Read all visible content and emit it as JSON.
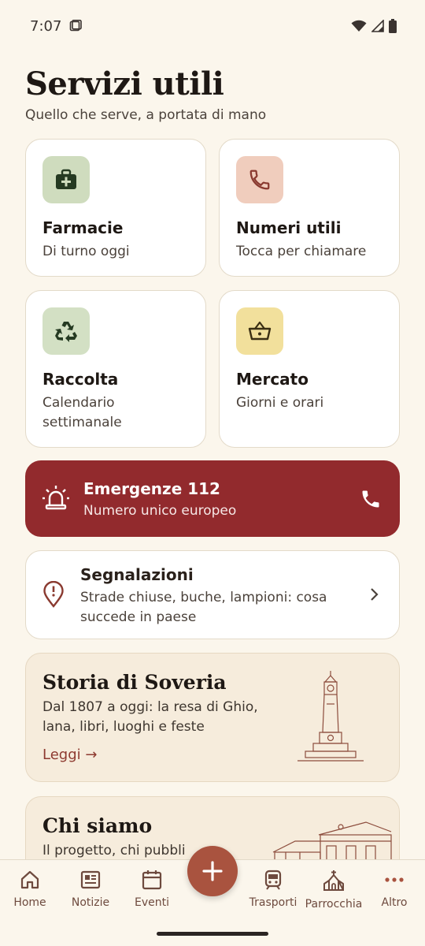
{
  "status": {
    "time": "7:07"
  },
  "header": {
    "title": "Servizi utili",
    "subtitle": "Quello che serve, a portata di mano"
  },
  "tiles": [
    {
      "title": "Farmacie",
      "subtitle": "Di turno oggi",
      "icon": "medical-bag-icon",
      "color": "#cfdcbe"
    },
    {
      "title": "Numeri utili",
      "subtitle": "Tocca per chiamare",
      "icon": "phone-icon",
      "color": "#f0cdbd"
    },
    {
      "title": "Raccolta",
      "subtitle": "Calendario settimanale",
      "icon": "recycle-icon",
      "color": "#d3e0c4"
    },
    {
      "title": "Mercato",
      "subtitle": "Giorni e orari",
      "icon": "basket-icon",
      "color": "#f2e09c"
    }
  ],
  "emergency": {
    "title": "Emergenze 112",
    "subtitle": "Numero unico europeo",
    "color": "#922a2d"
  },
  "report": {
    "title": "Segnalazioni",
    "subtitle": "Strade chiuse, buche, lampioni: cosa succede in paese"
  },
  "story": {
    "title": "Storia di Soveria",
    "subtitle": "Dal 1807 a oggi: la resa di Ghio, lana, libri, luoghi e feste",
    "link": "Leggi →"
  },
  "about": {
    "title": "Chi siamo",
    "subtitle": "Il progetto, chi pubbli"
  },
  "nav": [
    {
      "label": "Home",
      "icon": "home-icon"
    },
    {
      "label": "Notizie",
      "icon": "newspaper-icon"
    },
    {
      "label": "Eventi",
      "icon": "calendar-icon"
    },
    {
      "label": "Trasporti",
      "icon": "train-icon"
    },
    {
      "label": "Parrocchia",
      "icon": "church-icon"
    },
    {
      "label": "Altro",
      "icon": "more-icon"
    }
  ]
}
